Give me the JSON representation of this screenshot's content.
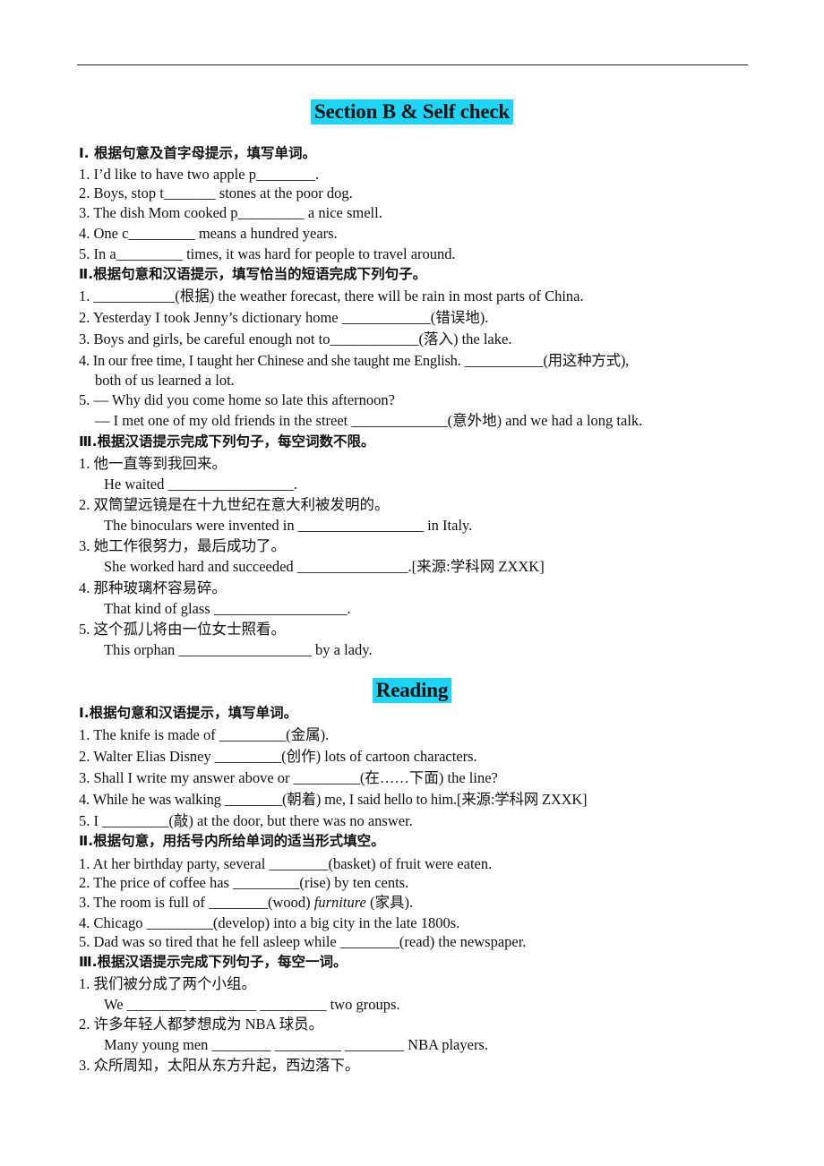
{
  "section_b": {
    "heading": "Section B & Self check",
    "part1": {
      "title": "Ⅰ. 根据句意及首字母提示，填写单词。",
      "items": [
        {
          "pre": "1. I’d like to have two apple p",
          "blank": "________",
          "post": "."
        },
        {
          "pre": "2. Boys, stop t",
          "blank": "_______",
          "post": " stones at the poor dog."
        },
        {
          "pre": "3. The dish Mom cooked p",
          "blank": "_________",
          "post": " a nice smell."
        },
        {
          "pre": "4. One c",
          "blank": "_________",
          "post": " means a hundred years."
        },
        {
          "pre": "5. In a",
          "blank": "_________",
          "post": " times, it was hard for people to travel around."
        }
      ]
    },
    "part2": {
      "title": "Ⅱ.根据句意和汉语提示，填写恰当的短语完成下列句子。",
      "items": [
        {
          "pre": "1. ",
          "blank": "___________",
          "post": "(根据) the weather forecast, there will be rain in most parts of China."
        },
        {
          "pre": "2. Yesterday I took Jenny’s dictionary home ",
          "blank": "____________",
          "post": "(错误地)."
        },
        {
          "pre": "3. Boys and girls, be careful enough not to",
          "blank": "____________",
          "post": "(落入) the lake."
        },
        {
          "pre": "4. In our free time, I taught her Chinese and she taught me English. ",
          "blank": "___________",
          "post": "(用这种方式),",
          "cont": "both of us learned a lot."
        },
        {
          "pre": "5. — Why did you come home so late this afternoon?",
          "blank": "",
          "post": "",
          "cont_pre": "— I met one of my old friends in the street ",
          "cont_blank": "_____________",
          "cont_post": "(意外地) and we had a long talk."
        }
      ]
    },
    "part3": {
      "title": "Ⅲ.根据汉语提示完成下列句子，每空词数不限。",
      "items": [
        {
          "cn": "1.  他一直等到我回来。",
          "pre": "He waited ",
          "blank": "_________________",
          "post": "."
        },
        {
          "cn": "2.  双筒望远镜是在十九世纪在意大利被发明的。",
          "pre": "The binoculars were invented in ",
          "blank": "_________________",
          "post": " in Italy."
        },
        {
          "cn": "3.  她工作很努力，最后成功了。",
          "pre": "She worked hard and succeeded ",
          "blank": "_______________",
          "post": ".[来源:学科网 ZXXK]"
        },
        {
          "cn": "4.  那种玻璃杯容易碎。",
          "pre": "That kind of glass ",
          "blank": "__________________",
          "post": "."
        },
        {
          "cn": "5.  这个孤儿将由一位女士照看。",
          "pre": "This orphan ",
          "blank": "__________________",
          "post": " by a lady."
        }
      ]
    }
  },
  "reading": {
    "heading": "Reading",
    "part1": {
      "title": "Ⅰ.根据句意和汉语提示，填写单词。",
      "items": [
        {
          "pre": "1. The knife is made of ",
          "blank": "_________",
          "post": "(金属)."
        },
        {
          "pre": "2. Walter Elias Disney ",
          "blank": "_________",
          "post": "(创作) lots of cartoon characters."
        },
        {
          "pre": "3. Shall I write my answer above or ",
          "blank": "_________",
          "post": "(在……下面) the line?"
        },
        {
          "pre": "4. While  he was walking ",
          "blank": "________",
          "post": "(朝着) me, I said hello to him.[来源:学科网 ZXXK]"
        },
        {
          "pre": "5. I ",
          "blank": "_________",
          "post": "(敲) at the door, but there was no answer."
        }
      ]
    },
    "part2": {
      "title": "Ⅱ.根据句意，用括号内所给单词的适当形式填空。",
      "items": [
        {
          "pre": "1. At her birthday party, several ",
          "blank": "________",
          "post": "(basket) of fruit were eaten."
        },
        {
          "pre": "2. The price of coffee has ",
          "blank": "_________",
          "post": "(rise) by ten cents."
        },
        {
          "pre": "3. The room is full of ",
          "blank": "________",
          "post": "(wood) ",
          "italic": "furniture",
          "post2": " (家具)."
        },
        {
          "pre": "4. Chicago ",
          "blank": "_________",
          "post": "(develop) into a big city in the late 1800s."
        },
        {
          "pre": "5. Dad was so tired that he fell asleep while ",
          "blank": "________",
          "post": "(read) the newspaper."
        }
      ]
    },
    "part3": {
      "title": "Ⅲ.根据汉语提示完成下列句子，每空一词。",
      "items": [
        {
          "cn": "1.  我们被分成了两个小组。",
          "pre": "We ",
          "blanks": [
            "________",
            "_________",
            "_________"
          ],
          "post": " two groups."
        },
        {
          "cn": "2.  许多年轻人都梦想成为 NBA 球员。",
          "pre": "Many young men ",
          "blanks": [
            "________",
            "_________",
            "________"
          ],
          "post": " NBA players."
        },
        {
          "cn": "3.  众所周知，太阳从东方升起，西边落下。"
        }
      ]
    }
  }
}
